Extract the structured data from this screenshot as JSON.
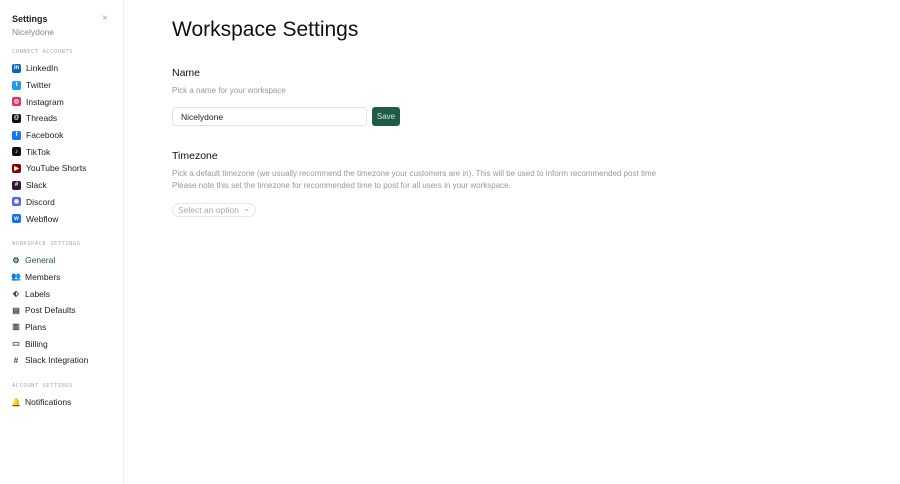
{
  "sidebar": {
    "title": "Settings",
    "subtitle": "Nicelydone",
    "close": "×",
    "connect_label": "Connect Accounts",
    "connect": [
      {
        "label": "LinkedIn",
        "icon": "linkedin-icon",
        "color": "#0a66c2",
        "glyph": "in"
      },
      {
        "label": "Twitter",
        "icon": "twitter-icon",
        "color": "#1d9bf0",
        "glyph": "t"
      },
      {
        "label": "Instagram",
        "icon": "instagram-icon",
        "color": "#e1306c",
        "glyph": "◎"
      },
      {
        "label": "Threads",
        "icon": "threads-icon",
        "color": "#111111",
        "glyph": "@"
      },
      {
        "label": "Facebook",
        "icon": "facebook-icon",
        "color": "#1877f2",
        "glyph": "f"
      },
      {
        "label": "TikTok",
        "icon": "tiktok-icon",
        "color": "#111111",
        "glyph": "♪"
      },
      {
        "label": "YouTube Shorts",
        "icon": "youtube-shorts-icon",
        "color": "#8b0000",
        "glyph": "▶"
      },
      {
        "label": "Slack",
        "icon": "slack-icon",
        "color": "#3b1340",
        "glyph": "#"
      },
      {
        "label": "Discord",
        "icon": "discord-icon",
        "color": "#5865f2",
        "glyph": "◉"
      },
      {
        "label": "Webflow",
        "icon": "webflow-icon",
        "color": "#146ef5",
        "glyph": "w"
      }
    ],
    "workspace_label": "Workspace Settings",
    "workspace": [
      {
        "label": "General",
        "icon": "gear-icon",
        "glyph": "⚙"
      },
      {
        "label": "Members",
        "icon": "users-icon",
        "glyph": "👥"
      },
      {
        "label": "Labels",
        "icon": "tag-icon",
        "glyph": "⬖"
      },
      {
        "label": "Post Defaults",
        "icon": "document-icon",
        "glyph": "▤"
      },
      {
        "label": "Plans",
        "icon": "map-icon",
        "glyph": "▥"
      },
      {
        "label": "Billing",
        "icon": "credit-card-icon",
        "glyph": "▭"
      },
      {
        "label": "Slack Integration",
        "icon": "slack-color-icon",
        "glyph": "#"
      }
    ],
    "account_label": "Account Settings",
    "account": [
      {
        "label": "Notifications",
        "icon": "bell-icon",
        "glyph": "🔔"
      }
    ]
  },
  "main": {
    "title": "Workspace Settings",
    "name_heading": "Name",
    "name_desc": "Pick a name for your workspace",
    "name_value": "Nicelydone",
    "save": "Save",
    "tz_heading": "Timezone",
    "tz_desc1": "Pick a default timezone (we usually recommend the timezone your customers are in). This will be used to inform recommended post time",
    "tz_desc2": "Please note this set the timezone for recommended time to post for all users in your workspace.",
    "tz_placeholder": "Select an option",
    "chevron": "⌄"
  }
}
